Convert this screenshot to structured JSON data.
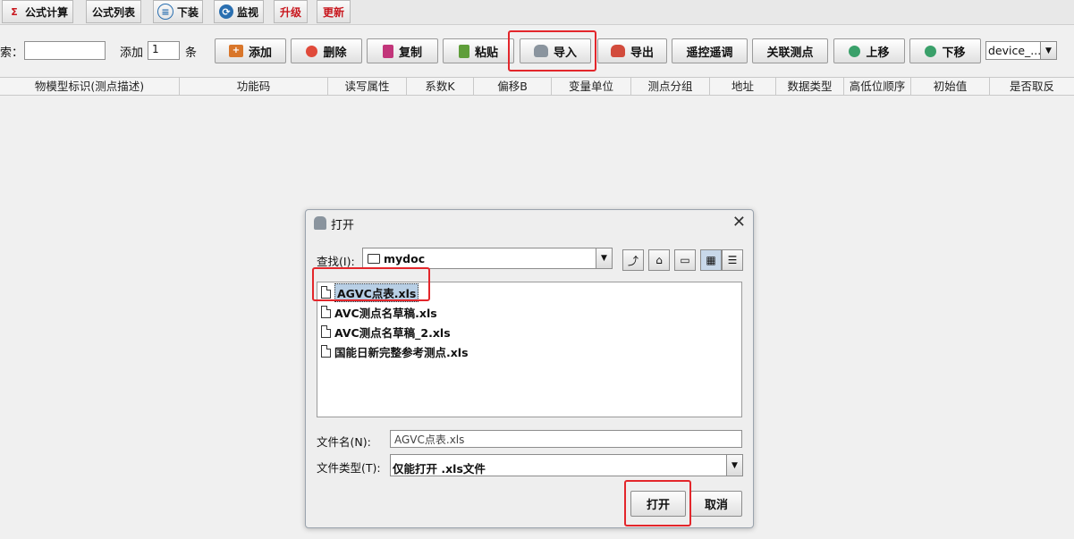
{
  "topbar": {
    "formula_calc": "公式计算",
    "formula_list": "公式列表",
    "download": "下装",
    "monitor": "监视",
    "upgrade": "升级",
    "update": "更新"
  },
  "toolbar": {
    "search_label": "索：",
    "search_value": "",
    "add_label": "添加",
    "add_count": "1",
    "add_unit": "条",
    "btn_add": "添加",
    "btn_delete": "删除",
    "btn_copy": "复制",
    "btn_paste": "粘贴",
    "btn_import": "导入",
    "btn_export": "导出",
    "btn_remote": "遥控遥调",
    "btn_link": "关联测点",
    "btn_up": "上移",
    "btn_down": "下移",
    "device_select": "device_..."
  },
  "table": {
    "columns": [
      "物模型标识(测点描述)",
      "功能码",
      "读写属性",
      "系数K",
      "偏移B",
      "变量单位",
      "测点分组",
      "地址",
      "数据类型",
      "高低位顺序",
      "初始值",
      "是否取反"
    ]
  },
  "dialog": {
    "title": "打开",
    "lookin_label": "查找(I):",
    "lookin_value": "mydoc",
    "files": [
      "AGVC点表.xls",
      "AVC测点名草稿.xls",
      "AVC测点名草稿_2.xls",
      "国能日新完整参考测点.xls"
    ],
    "filename_label": "文件名(N):",
    "filename_value": "AGVC点表.xls",
    "filetype_label": "文件类型(T):",
    "filetype_value": "仅能打开 .xls文件",
    "open_button": "打开",
    "cancel_button": "取消"
  },
  "colors": {
    "highlight": "#e3262b",
    "selection": "#b8cfe5"
  }
}
